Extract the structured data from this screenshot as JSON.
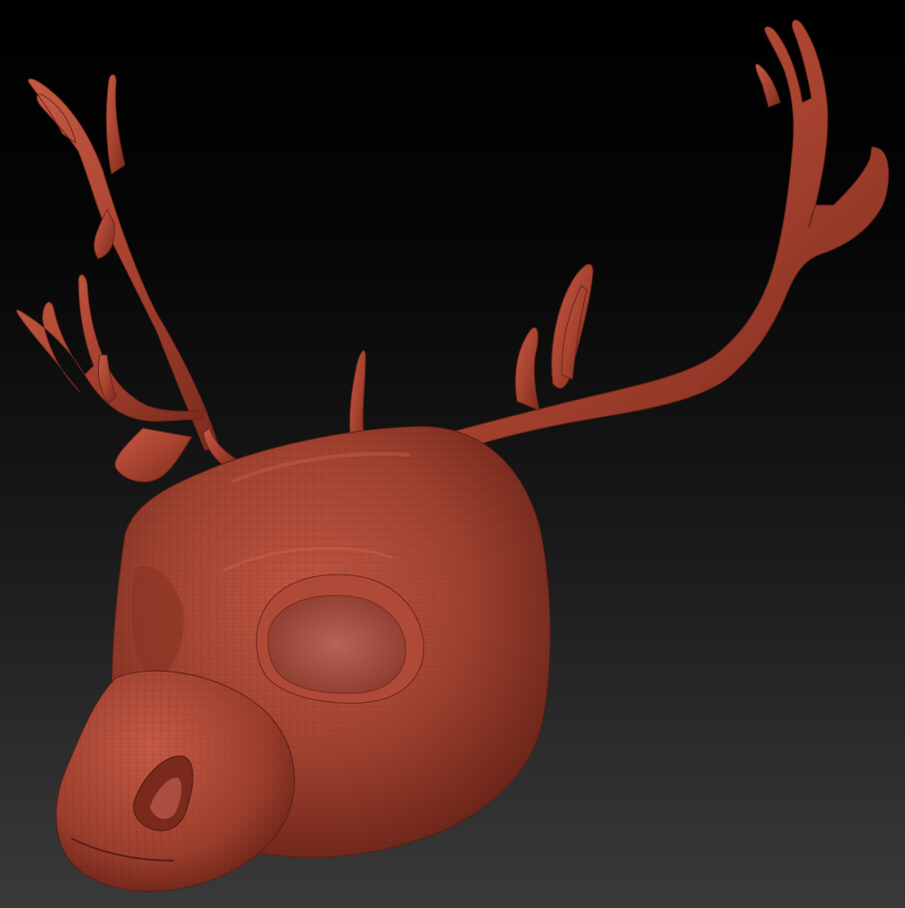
{
  "viewport": {
    "background_top": "#000000",
    "background_bottom": "#3a3a3a"
  },
  "model": {
    "subject": "deer-head-sculpt",
    "material_base": "#9a3c2a",
    "material_light": "#c85a44",
    "material_dark": "#5a1e14",
    "wireframe_visible": true
  }
}
